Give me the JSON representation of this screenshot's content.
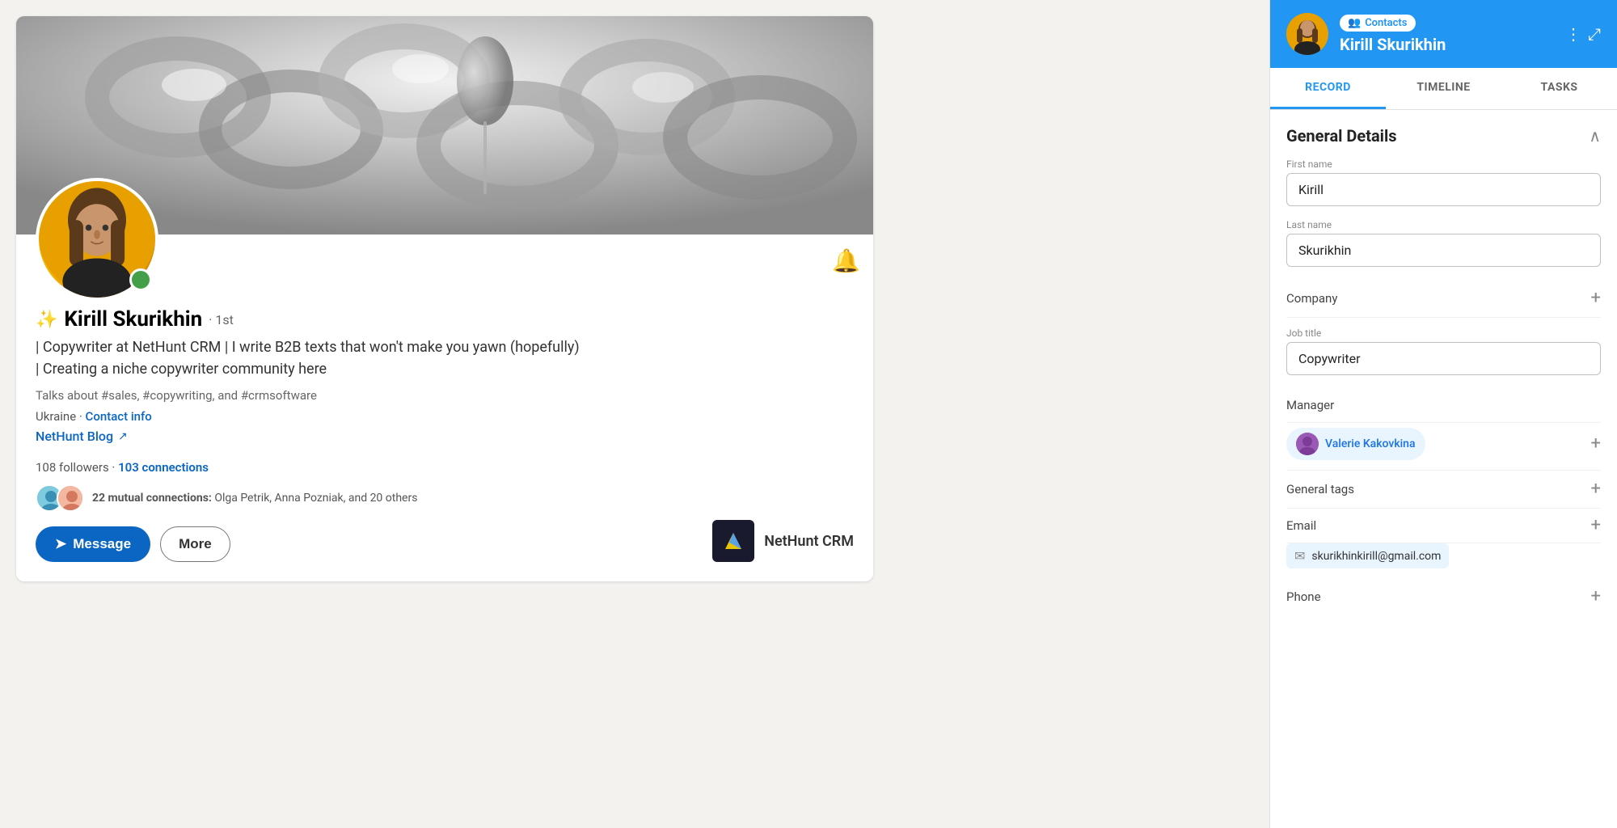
{
  "linkedin": {
    "profile": {
      "name": "Kirill Skurikhin",
      "degree": "· 1st",
      "headline": "| Copywriter at NetHunt CRM | I write B2B texts that won't make you yawn (hopefully) | Creating a niche copywriter community here",
      "talks_about": "Talks about #sales, #copywriting, and #crmsoftware",
      "location": "Ukraine",
      "contact_info_label": "Contact info",
      "blog_label": "NetHunt Blog",
      "followers": "108 followers",
      "connections": "103 connections",
      "mutual_count": "22 mutual connections:",
      "mutual_names": "Olga Petrik, Anna Pozniak, and 20 others",
      "btn_message": "Message",
      "btn_more": "More",
      "company_name": "NetHunt CRM"
    }
  },
  "crm": {
    "header": {
      "badge_label": "Contacts",
      "contact_name": "Kirill Skurikhin",
      "menu_icon": "⋮",
      "external_icon": "⤢"
    },
    "tabs": [
      {
        "label": "RECORD",
        "active": true
      },
      {
        "label": "TIMELINE",
        "active": false
      },
      {
        "label": "TASKS",
        "active": false
      }
    ],
    "general_details": {
      "title": "General Details",
      "first_name_label": "First name",
      "first_name_value": "Kirill",
      "last_name_label": "Last name",
      "last_name_value": "Skurikhin",
      "company_label": "Company",
      "job_title_label": "Job title",
      "job_title_value": "Copywriter",
      "manager_label": "Manager",
      "manager_name": "Valerie Kakovkina",
      "general_tags_label": "General tags",
      "email_label": "Email",
      "email_value": "skurikhinkirill@gmail.com",
      "phone_label": "Phone"
    }
  },
  "icons": {
    "bell": "🔔",
    "message_arrow": "➤",
    "person_badge": "👤",
    "contacts_people": "👥",
    "chevron_up": "∧",
    "plus": "+",
    "envelope": "✉",
    "external_link": "↗"
  }
}
